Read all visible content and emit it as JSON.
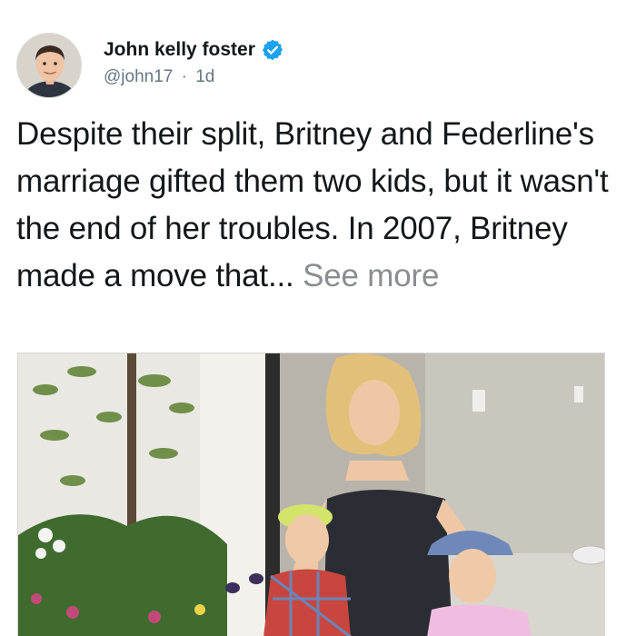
{
  "author": {
    "name": "John kelly foster",
    "handle": "@john17",
    "separator": "·",
    "time": "1d",
    "verified": true
  },
  "tweet": {
    "text": "Despite their split, Britney and Federline's marriage gifted them two kids, but it wasn't the end of her troubles. In 2007, Britney made a move that...",
    "see_more": "See more"
  },
  "media": {
    "type": "photo"
  },
  "colors": {
    "verified_badge": "#1da1f2",
    "text": "#14171a",
    "secondary_text": "#657786",
    "see_more": "#8a8d91"
  },
  "icons": {
    "verified": "verified-badge-icon"
  }
}
